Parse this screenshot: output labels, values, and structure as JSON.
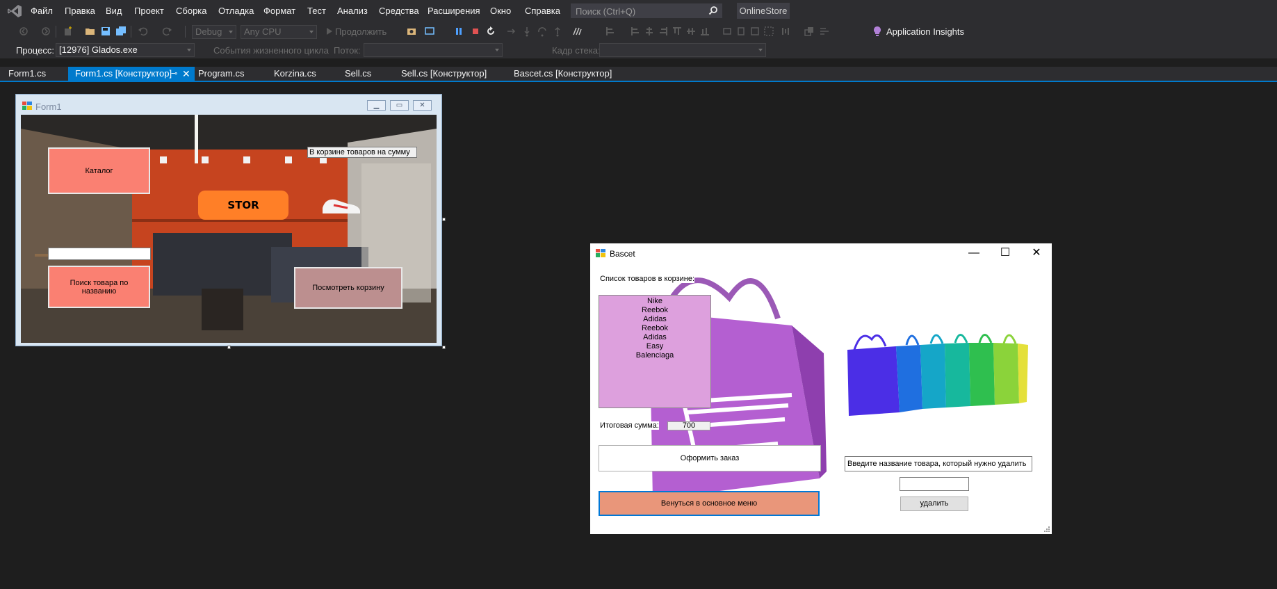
{
  "menu": {
    "items": [
      "Файл",
      "Правка",
      "Вид",
      "Проект",
      "Сборка",
      "Отладка",
      "Формат",
      "Тест",
      "Анализ",
      "Средства",
      "Расширения",
      "Окно",
      "Справка"
    ],
    "search_placeholder": "Поиск (Ctrl+Q)",
    "solution_name": "OnlineStore"
  },
  "toolbar": {
    "config": "Debug",
    "platform": "Any CPU",
    "continue_label": "Продолжить",
    "app_insights": "Application Insights",
    "process_label": "Процесс:",
    "process_value": "[12976] Glados.exe",
    "lifecycle_label": "События жизненного цикла",
    "thread_label": "Поток:",
    "stack_label": "Кадр стека:"
  },
  "tabs": [
    {
      "label": "Form1.cs",
      "active": false
    },
    {
      "label": "Form1.cs [Конструктор]",
      "active": true
    },
    {
      "label": "Program.cs",
      "active": false
    },
    {
      "label": "Korzina.cs",
      "active": false
    },
    {
      "label": "Sell.cs",
      "active": false
    },
    {
      "label": "Sell.cs [Конструктор]",
      "active": false
    },
    {
      "label": "Bascet.cs [Конструктор]",
      "active": false
    }
  ],
  "form1": {
    "title": "Form1",
    "catalog_button": "Каталог",
    "basket_sum_label": "В корзине товаров на сумму",
    "store_sign": "STOR",
    "search_input_value": "",
    "search_button": "Поиск товара по названию",
    "view_basket_button": "Посмотреть корзину"
  },
  "bascet": {
    "title": "Bascet",
    "list_label": "Список товаров в корзине:",
    "items": [
      "Nike",
      "Reebok",
      "Adidas",
      "Reebok",
      "Adidas",
      "Easy",
      "Balenciaga"
    ],
    "total_label": "Итоговая сумма:",
    "total_value": "700",
    "order_button": "Оформить заказ",
    "back_button": "Венуться в основное меню",
    "delete_prompt": "Введите название товара, который нужно удалить",
    "delete_input_value": "",
    "delete_button": "удалить"
  },
  "colors": {
    "accent": "#007acc",
    "salmon": "#fa8072",
    "list_bg": "#dda0dd",
    "back_button_bg": "#e9967a"
  }
}
